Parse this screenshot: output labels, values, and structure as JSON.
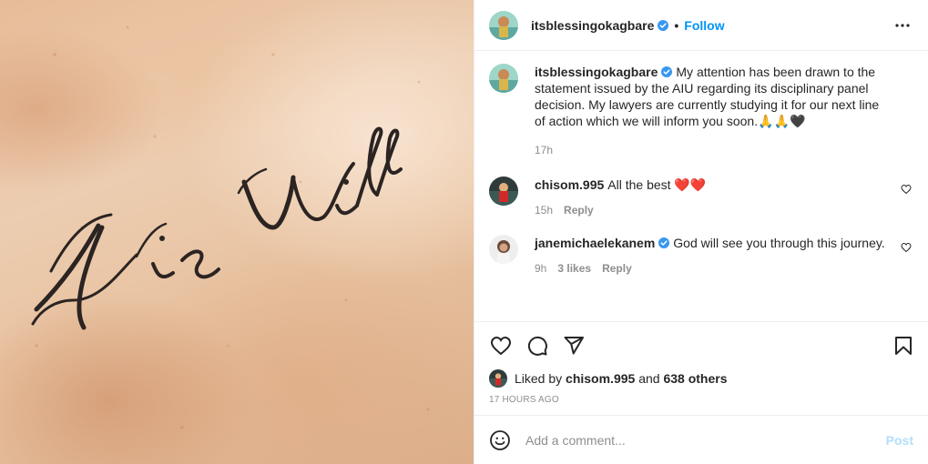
{
  "media": {
    "tattoo_text": "His Will",
    "icon": "tattoo-photo"
  },
  "header": {
    "username": "itsblessingokagbare",
    "dot": "•",
    "follow_label": "Follow",
    "more_icon": "more-horizontal-icon"
  },
  "caption": {
    "username": "itsblessingokagbare",
    "text": "My attention has been drawn to the statement issued by the AIU regarding its disciplinary panel decision. My lawyers are currently studying it for our next line of action which we will inform you soon.🙏🙏🖤",
    "time": "17h"
  },
  "comments": [
    {
      "username": "chisom.995",
      "text": "All the best ❤️❤️",
      "time": "15h",
      "likes": "",
      "reply_label": "Reply"
    },
    {
      "username": "janemichaelekanem",
      "text": "God will see you through this journey.",
      "time": "9h",
      "likes": "3 likes",
      "reply_label": "Reply"
    }
  ],
  "actions": {
    "icons": [
      "heart-icon",
      "comment-icon",
      "share-icon",
      "bookmark-icon"
    ]
  },
  "liked_by": {
    "prefix": "Liked by",
    "user": "chisom.995",
    "middle": "and",
    "others": "638 others"
  },
  "timestamp": "17 HOURS AGO",
  "add_comment": {
    "placeholder": "Add a comment...",
    "post_label": "Post"
  },
  "colors": {
    "accent": "#0095f6",
    "post_disabled": "#b2dffc",
    "verified": "#3897f0",
    "muted": "#8e8e8e"
  }
}
